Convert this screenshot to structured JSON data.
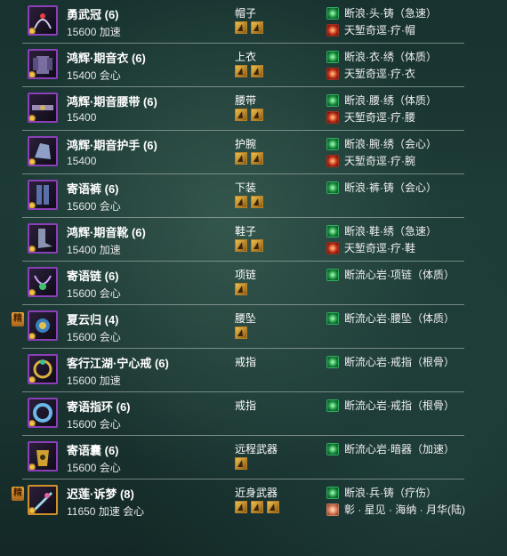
{
  "items": [
    {
      "name": "勇武冠 (6)",
      "stats": "15600 加速",
      "slot": "帽子",
      "gems": 2,
      "border": "purple",
      "tag": "",
      "enh1": {
        "icon": "green",
        "text": "断浪·头·铸（急速）"
      },
      "enh2": {
        "icon": "red",
        "text": "天堑奇逕·疗·帽"
      }
    },
    {
      "name": "鸿辉·期音衣 (6)",
      "stats": "15400 会心",
      "slot": "上衣",
      "gems": 2,
      "border": "purple",
      "tag": "",
      "enh1": {
        "icon": "green",
        "text": "断浪·衣·绣（体质）"
      },
      "enh2": {
        "icon": "red",
        "text": "天堑奇逕·疗·衣"
      }
    },
    {
      "name": "鸿辉·期音腰带 (6)",
      "stats": "15400",
      "slot": "腰带",
      "gems": 2,
      "border": "purple",
      "tag": "",
      "enh1": {
        "icon": "green",
        "text": "断浪·腰·绣（体质）"
      },
      "enh2": {
        "icon": "red",
        "text": "天堑奇逕·疗·腰"
      }
    },
    {
      "name": "鸿辉·期音护手 (6)",
      "stats": "15400",
      "slot": "护腕",
      "gems": 2,
      "border": "purple",
      "tag": "",
      "enh1": {
        "icon": "green",
        "text": "断浪·腕·绣（会心）"
      },
      "enh2": {
        "icon": "red",
        "text": "天堑奇逕·疗·腕"
      }
    },
    {
      "name": "寄语裤 (6)",
      "stats": "15600 会心",
      "slot": "下装",
      "gems": 2,
      "border": "purple",
      "tag": "",
      "enh1": {
        "icon": "green",
        "text": "断浪·裤·铸（会心）"
      },
      "enh2": null
    },
    {
      "name": "鸿辉·期音靴 (6)",
      "stats": "15400 加速",
      "slot": "鞋子",
      "gems": 2,
      "border": "purple",
      "tag": "",
      "enh1": {
        "icon": "green",
        "text": "断浪·鞋·绣（急速）"
      },
      "enh2": {
        "icon": "red",
        "text": "天堑奇逕·疗·鞋"
      }
    },
    {
      "name": "寄语链 (6)",
      "stats": "15600 会心",
      "slot": "项链",
      "gems": 1,
      "border": "purple",
      "tag": "",
      "enh1": {
        "icon": "green",
        "text": "断流心岩·项链（体质）"
      },
      "enh2": null
    },
    {
      "name": "夏云归 (4)",
      "stats": "15600 会心",
      "slot": "腰坠",
      "gems": 1,
      "border": "purple",
      "tag": "精",
      "enh1": {
        "icon": "green",
        "text": "断流心岩·腰坠（体质）"
      },
      "enh2": null
    },
    {
      "name": "客行江湖·宁心戒 (6)",
      "stats": "15600 加速",
      "slot": "戒指",
      "gems": 0,
      "border": "purple",
      "tag": "",
      "enh1": {
        "icon": "green",
        "text": "断流心岩·戒指（根骨）"
      },
      "enh2": null
    },
    {
      "name": "寄语指环 (6)",
      "stats": "15600 会心",
      "slot": "戒指",
      "gems": 0,
      "border": "purple",
      "tag": "",
      "enh1": {
        "icon": "green",
        "text": "断流心岩·戒指（根骨）"
      },
      "enh2": null
    },
    {
      "name": "寄语囊 (6)",
      "stats": "15600 会心",
      "slot": "远程武器",
      "gems": 1,
      "border": "purple",
      "tag": "",
      "enh1": {
        "icon": "green",
        "text": "断流心岩·暗器（加速）"
      },
      "enh2": null
    },
    {
      "name": "迟莲·诉梦 (8)",
      "stats": "11650 加速 会心",
      "slot": "近身武器",
      "gems": 3,
      "border": "gold",
      "tag": "精",
      "enh1": {
        "icon": "green",
        "text": "断浪·兵·铸（疗伤）"
      },
      "enh2": {
        "icon": "peach",
        "text": "彰 · 星见 · 海纳 · 月华(陆)"
      }
    }
  ],
  "colors": {
    "accent_purple": "#8b3fb8",
    "accent_gold": "#d0902a",
    "divider": "#bec8c3"
  }
}
